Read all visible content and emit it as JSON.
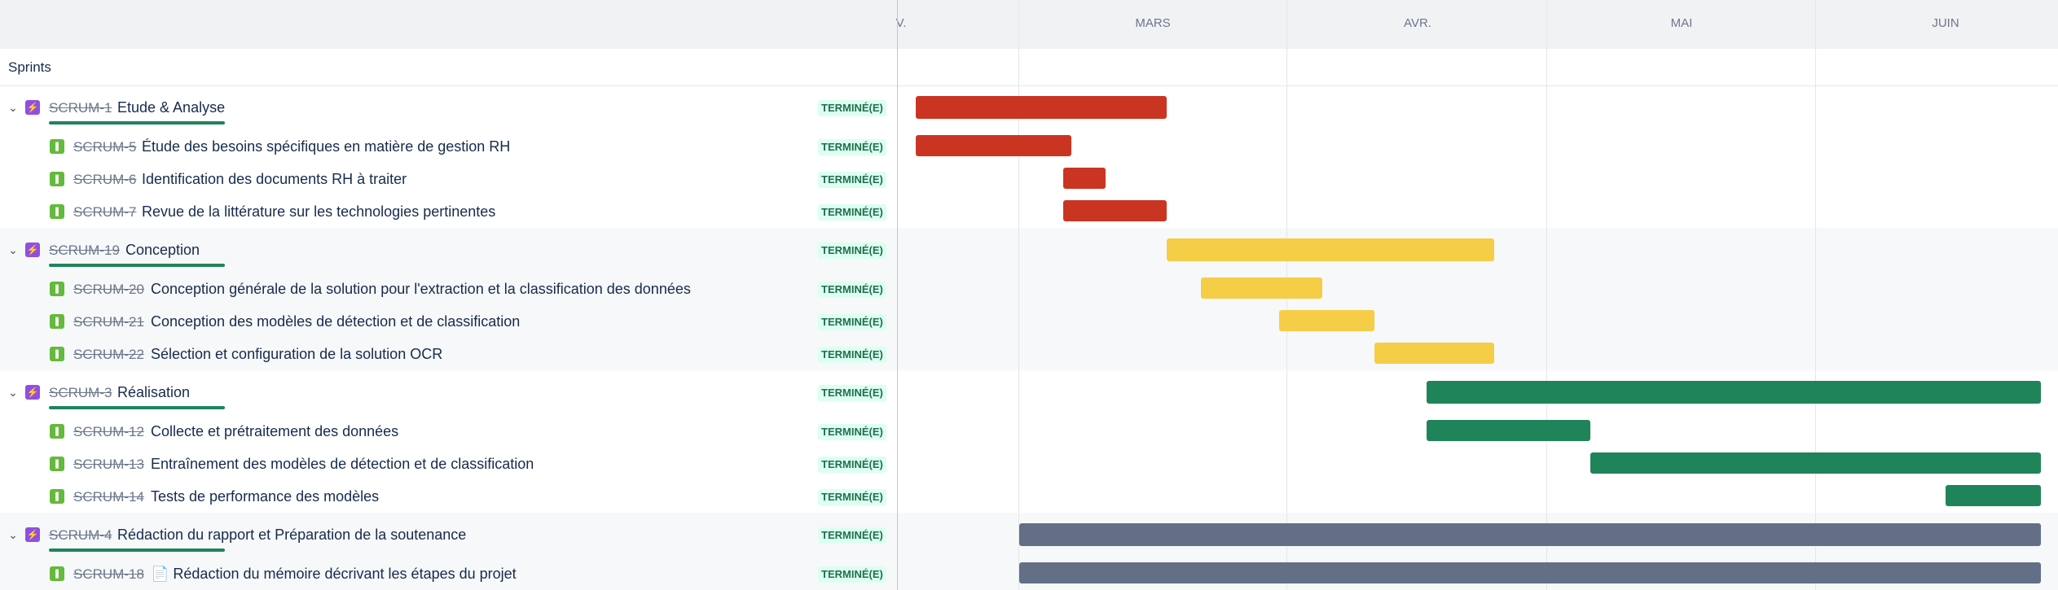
{
  "timeline": {
    "months": [
      {
        "label": "V.",
        "id": "fev"
      },
      {
        "label": "MARS",
        "id": "mars"
      },
      {
        "label": "AVR.",
        "id": "avr"
      },
      {
        "label": "MAI",
        "id": "mai"
      },
      {
        "label": "JUIN",
        "id": "juin"
      }
    ]
  },
  "sprints_label": "Sprints",
  "colors": {
    "red": "#ca3521",
    "yellow": "#f5cd47",
    "green": "#1f845a",
    "gray": "#626f86",
    "epic": "#904ee2",
    "story": "#63ba3c",
    "status_bg": "#dcfff1",
    "status_text": "#216e4e"
  },
  "groups": [
    {
      "epic": {
        "key": "SCRUM-1",
        "title": "Etude & Analyse",
        "status": "TERMINÉ(E)"
      },
      "stories": [
        {
          "key": "SCRUM-5",
          "title": "Étude des besoins spécifiques en matière de gestion RH",
          "status": "TERMINÉ(E)"
        },
        {
          "key": "SCRUM-6",
          "title": "Identification des documents RH à traiter",
          "status": "TERMINÉ(E)"
        },
        {
          "key": "SCRUM-7",
          "title": "Revue de la littérature sur les technologies pertinentes",
          "status": "TERMINÉ(E)"
        }
      ]
    },
    {
      "epic": {
        "key": "SCRUM-19",
        "title": "Conception",
        "status": "TERMINÉ(E)"
      },
      "stories": [
        {
          "key": "SCRUM-20",
          "title": "Conception générale de la solution pour l'extraction et la classification des données",
          "status": "TERMINÉ(E)"
        },
        {
          "key": "SCRUM-21",
          "title": "Conception des modèles de détection et de classification",
          "status": "TERMINÉ(E)"
        },
        {
          "key": "SCRUM-22",
          "title": "Sélection et configuration de la solution OCR",
          "status": "TERMINÉ(E)"
        }
      ]
    },
    {
      "epic": {
        "key": "SCRUM-3",
        "title": "Réalisation",
        "status": "TERMINÉ(E)"
      },
      "stories": [
        {
          "key": "SCRUM-12",
          "title": "Collecte et prétraitement des données",
          "status": "TERMINÉ(E)"
        },
        {
          "key": "SCRUM-13",
          "title": "Entraînement des modèles de détection et de classification",
          "status": "TERMINÉ(E)"
        },
        {
          "key": "SCRUM-14",
          "title": "Tests de performance des modèles",
          "status": "TERMINÉ(E)"
        }
      ]
    },
    {
      "epic": {
        "key": "SCRUM-4",
        "title": "Rédaction du rapport et Préparation de la soutenance",
        "status": "TERMINÉ(E)"
      },
      "stories": [
        {
          "key": "SCRUM-18",
          "title": "📄 Rédaction du mémoire décrivant les étapes du projet",
          "status": "TERMINÉ(E)"
        }
      ]
    }
  ]
}
